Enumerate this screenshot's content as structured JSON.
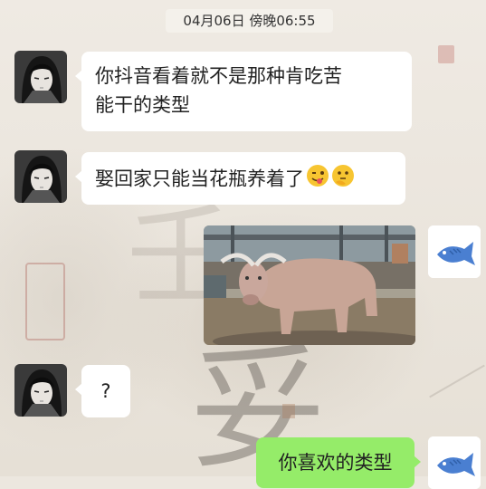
{
  "chat": {
    "timestamp": "04月06日 傍晚06:55",
    "messages": [
      {
        "sender": "contact",
        "type": "text",
        "text": "你抖音看着就不是那种肯吃苦"
      },
      {
        "sender": "contact",
        "type": "text",
        "text": "能干的类型"
      },
      {
        "sender": "contact",
        "type": "text",
        "text": "娶回家只能当花瓶养着了",
        "emojis": [
          "wink-tongue-emoji",
          "thinking-emoji"
        ]
      },
      {
        "sender": "me",
        "type": "image",
        "image": "water-buffalo-photo"
      },
      {
        "sender": "contact",
        "type": "text",
        "text": "?"
      },
      {
        "sender": "me",
        "type": "text",
        "text": "你喜欢的类型"
      }
    ]
  },
  "background": {
    "ink_glyphs": [
      "壬",
      "妥"
    ]
  },
  "colors": {
    "outgoing_bubble": "#95ec69",
    "incoming_bubble": "#ffffff",
    "fish_avatar": "#4a7fd1"
  }
}
